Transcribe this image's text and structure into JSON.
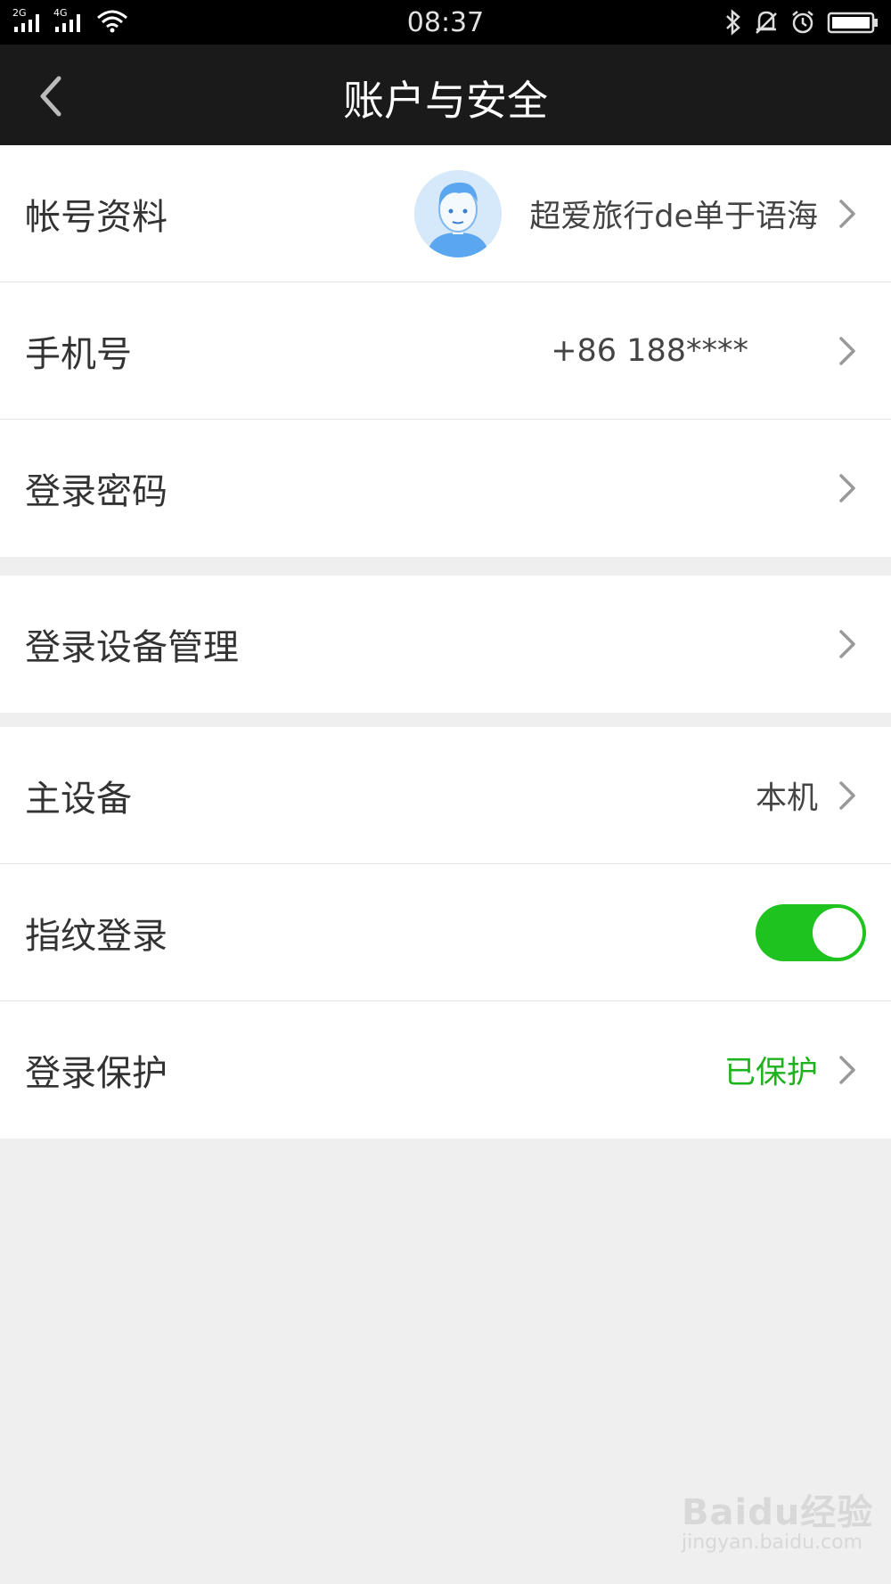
{
  "status_bar": {
    "time": "08:37",
    "network_1": "2G",
    "network_2": "4G",
    "icons": [
      "signal-icon",
      "wifi-icon",
      "bluetooth-icon",
      "bell-icon",
      "alarm-icon",
      "battery-icon"
    ]
  },
  "nav": {
    "title": "账户与安全",
    "back_icon": "chevron-left-icon"
  },
  "rows": {
    "account": {
      "label": "帐号资料",
      "value": "超爱旅行de单于语海"
    },
    "phone": {
      "label": "手机号",
      "value": "+86 188****"
    },
    "password": {
      "label": "登录密码"
    },
    "devices": {
      "label": "登录设备管理"
    },
    "main_device": {
      "label": "主设备",
      "value": "本机"
    },
    "fingerprint": {
      "label": "指纹登录",
      "enabled": true
    },
    "protection": {
      "label": "登录保护",
      "value": "已保护"
    }
  },
  "colors": {
    "accent_green": "#1fc31f",
    "header_bg": "#1a1a1a",
    "page_bg": "#efefef"
  },
  "watermark": {
    "brand": "Baidu经验",
    "url": "jingyan.baidu.com"
  }
}
